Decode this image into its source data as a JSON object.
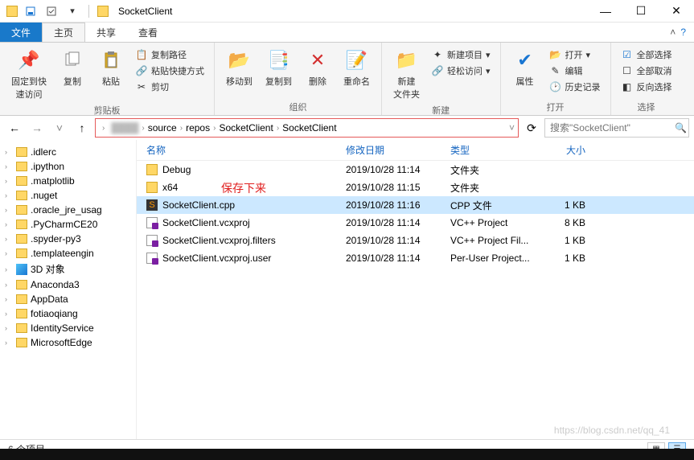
{
  "window": {
    "title": "SocketClient"
  },
  "tabs": {
    "file": "文件",
    "home": "主页",
    "share": "共享",
    "view": "查看"
  },
  "ribbon": {
    "pin": "固定到快\n速访问",
    "copy": "复制",
    "paste": "粘贴",
    "copypath": "复制路径",
    "pasteshortcut": "粘贴快捷方式",
    "cut": "剪切",
    "group_clipboard": "剪贴板",
    "moveto": "移动到",
    "copyto": "复制到",
    "delete": "删除",
    "rename": "重命名",
    "group_organize": "组织",
    "newfolder": "新建\n文件夹",
    "newitem": "新建项目",
    "easyaccess": "轻松访问",
    "group_new": "新建",
    "properties": "属性",
    "open": "打开",
    "edit": "编辑",
    "history": "历史记录",
    "group_open": "打开",
    "selectall": "全部选择",
    "selectnone": "全部取消",
    "invertsel": "反向选择",
    "group_select": "选择"
  },
  "breadcrumb": [
    "source",
    "repos",
    "SocketClient",
    "SocketClient"
  ],
  "search": {
    "placeholder": "搜索\"SocketClient\""
  },
  "annotation": "保存下来",
  "sidebar": [
    ".idlerc",
    ".ipython",
    ".matplotlib",
    ".nuget",
    ".oracle_jre_usag",
    ".PyCharmCE20",
    ".spyder-py3",
    ".templateengin",
    "3D 对象",
    "Anaconda3",
    "AppData",
    "fotiaoqiang",
    "IdentityService",
    "MicrosoftEdge"
  ],
  "columns": {
    "name": "名称",
    "date": "修改日期",
    "type": "类型",
    "size": "大小"
  },
  "files": [
    {
      "icon": "folder",
      "name": "Debug",
      "date": "2019/10/28 11:14",
      "type": "文件夹",
      "size": ""
    },
    {
      "icon": "folder",
      "name": "x64",
      "date": "2019/10/28 11:15",
      "type": "文件夹",
      "size": ""
    },
    {
      "icon": "cpp",
      "name": "SocketClient.cpp",
      "date": "2019/10/28 11:16",
      "type": "CPP 文件",
      "size": "1 KB",
      "selected": true
    },
    {
      "icon": "vcx",
      "name": "SocketClient.vcxproj",
      "date": "2019/10/28 11:14",
      "type": "VC++ Project",
      "size": "8 KB"
    },
    {
      "icon": "vcx",
      "name": "SocketClient.vcxproj.filters",
      "date": "2019/10/28 11:14",
      "type": "VC++ Project Fil...",
      "size": "1 KB"
    },
    {
      "icon": "vcx",
      "name": "SocketClient.vcxproj.user",
      "date": "2019/10/28 11:14",
      "type": "Per-User Project...",
      "size": "1 KB"
    }
  ],
  "status": "6 个项目",
  "watermark": "https://blog.csdn.net/qq_41"
}
